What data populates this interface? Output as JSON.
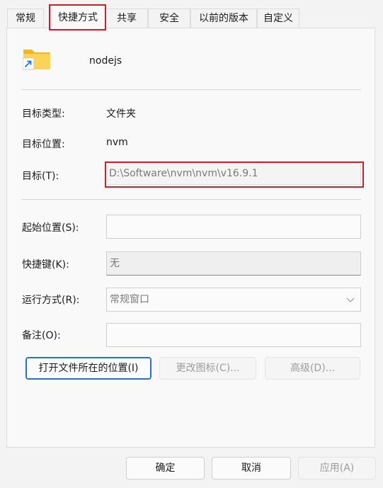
{
  "tabs": [
    {
      "label": "常规",
      "active": false
    },
    {
      "label": "快捷方式",
      "active": true
    },
    {
      "label": "共享",
      "active": false
    },
    {
      "label": "安全",
      "active": false
    },
    {
      "label": "以前的版本",
      "active": false
    },
    {
      "label": "自定义",
      "active": false
    }
  ],
  "header": {
    "name": "nodejs",
    "icon": "folder-shortcut-icon"
  },
  "info": {
    "type_label": "目标类型:",
    "type_value": "文件夹",
    "location_label": "目标位置:",
    "location_value": "nvm",
    "target_label": "目标(T):",
    "target_value": "D:\\Software\\nvm\\nvm\\v16.9.1"
  },
  "fields": {
    "start_in_label": "起始位置(S):",
    "start_in_value": "",
    "shortcut_key_label": "快捷键(K):",
    "shortcut_key_value": "无",
    "run_label": "运行方式(R):",
    "run_value": "常规窗口",
    "comment_label": "备注(O):",
    "comment_value": ""
  },
  "actions": {
    "open_location": "打开文件所在的位置(I)",
    "change_icon": "更改图标(C)...",
    "advanced": "高级(D)..."
  },
  "footer": {
    "ok": "确定",
    "cancel": "取消",
    "apply": "应用(A)"
  },
  "colors": {
    "highlight": "#d01f2a",
    "folder": "#f7c948",
    "shortcut_arrow": "#1a73e8"
  }
}
